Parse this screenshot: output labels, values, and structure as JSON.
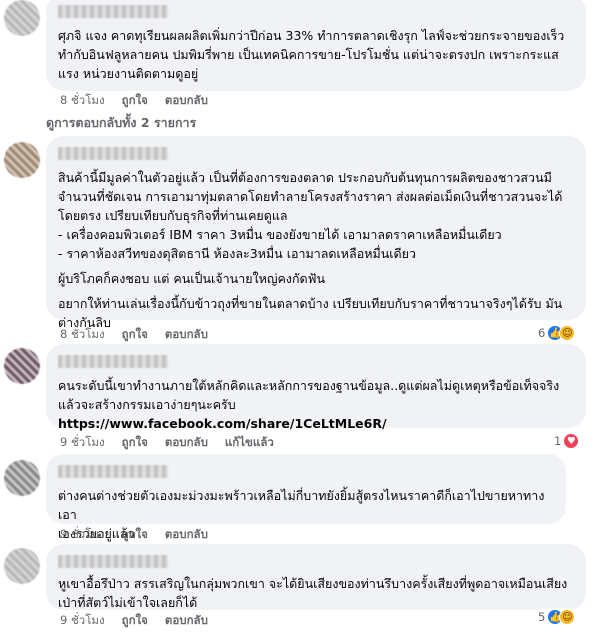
{
  "comments": [
    {
      "text": "ศุภจิ แจง คาดทุเรียนผลผลิตเพิ่มกว่าปีก่อน 33% ทำการตลาดเชิงรุก ไลฟ์จะช่วยกระจายของเร็ว\nทำกับอินฟลูหลายคน ปมพิมรี่พาย เป็นเทคนิคการขาย-โปรโมชั่น แต่น่าจะตรงปก เพราะกระแส\nแรง หน่วยงานติดตามดูอยู่",
      "time": "8 ชั่วโมง",
      "like": "ถูกใจ",
      "reply": "ตอบกลับ",
      "view_replies": "ดูการตอบกลับทั้ง 2 รายการ"
    },
    {
      "text": "สินค้านี้มีมูลค่าในตัวอยู่แล้ว เป็นที่ต้องการของตลาด ประกอบกับต้นทุนการผลิตของชาวสวนมี\nจำนวนที่ชัดเจน การเอามาทุ่มตลาดโดยทำลายโครงสร้างราคา ส่งผลต่อเม็ดเงินที่ชาวสวนจะได้\nโดยตรง เปรียบเทียบกับธุรกิจที่ท่านเคยดูแล\n- เครื่องคอมพิวเตอร์ IBM ราคา 3หมื่น ของยังขายได้ เอามาลดราคาเหลือหมื่นเดียว\n- ราคาห้องสวีทของดุสิตธานี ห้องละ3หมื่น เอามาลดเหลือหมื่นเดียว",
      "text2": "ผู้บริโภคก็คงชอบ แต่ คนเป็นเจ้านายใหญ่คงกัดฟัน",
      "text3": "อยากให้ท่านเล่นเรื่องนี้กับข้าวถุงที่ขายในตลาดบ้าง เปรียบเทียบกับราคาที่ชาวนาจริงๆได้รับ มัน\nต่างกันลิบ",
      "time": "8 ชั่วโมง",
      "like": "ถูกใจ",
      "reply": "ตอบกลับ",
      "reaction_count": "6"
    },
    {
      "text": "คนระดับนี้เขาทำงานภายใต้หลักคิดและหลักการของฐานข้อมูล..ดูแต่ผลไม่ดูเหตุหรือข้อเท็จจริง\nแล้วจะสร้างกรรมเอาง่ายๆนะครับ",
      "link": "https://www.facebook.com/share/1CeLtMLe6R/",
      "time": "9 ชั่วโมง",
      "like": "ถูกใจ",
      "reply": "ตอบกลับ",
      "edited": "แก้ไขแล้ว",
      "reaction_count": "1"
    },
    {
      "text": "ต่างคนต่างช่วยตัวเองมะม่วงมะพร้าวเหลือไม่กี่บาทยังยิ้มสู้ตรงไหนราคาดีก็เอาไปขายหาทางเอา\nเองรวยอยู่แล้ว",
      "time": "9 ชั่วโมง",
      "like": "ถูกใจ",
      "reply": "ตอบกลับ"
    },
    {
      "text": "หูเขาอื้อรึป่าว สรรเสริญในกลุ่มพวกเขา จะได้ยินเสียงของท่านรึบางครั้งเสียงที่พูดอาจเหมือนเสียง\nเป่าที่สัตว์ไม่เข้าใจเลยก็ได้",
      "time": "9 ชั่วโมง",
      "like": "ถูกใจ",
      "reply": "ตอบกลับ",
      "reaction_count": "5"
    }
  ],
  "icons": {
    "like": "like-icon",
    "haha": "haha-icon",
    "love": "love-icon",
    "reply_arrow": "reply-arrow-icon"
  },
  "colors": {
    "bubble": "#f0f2f5",
    "meta": "#65676b",
    "like": "#1877f2",
    "love": "#f33e58",
    "haha": "#f7b928"
  }
}
